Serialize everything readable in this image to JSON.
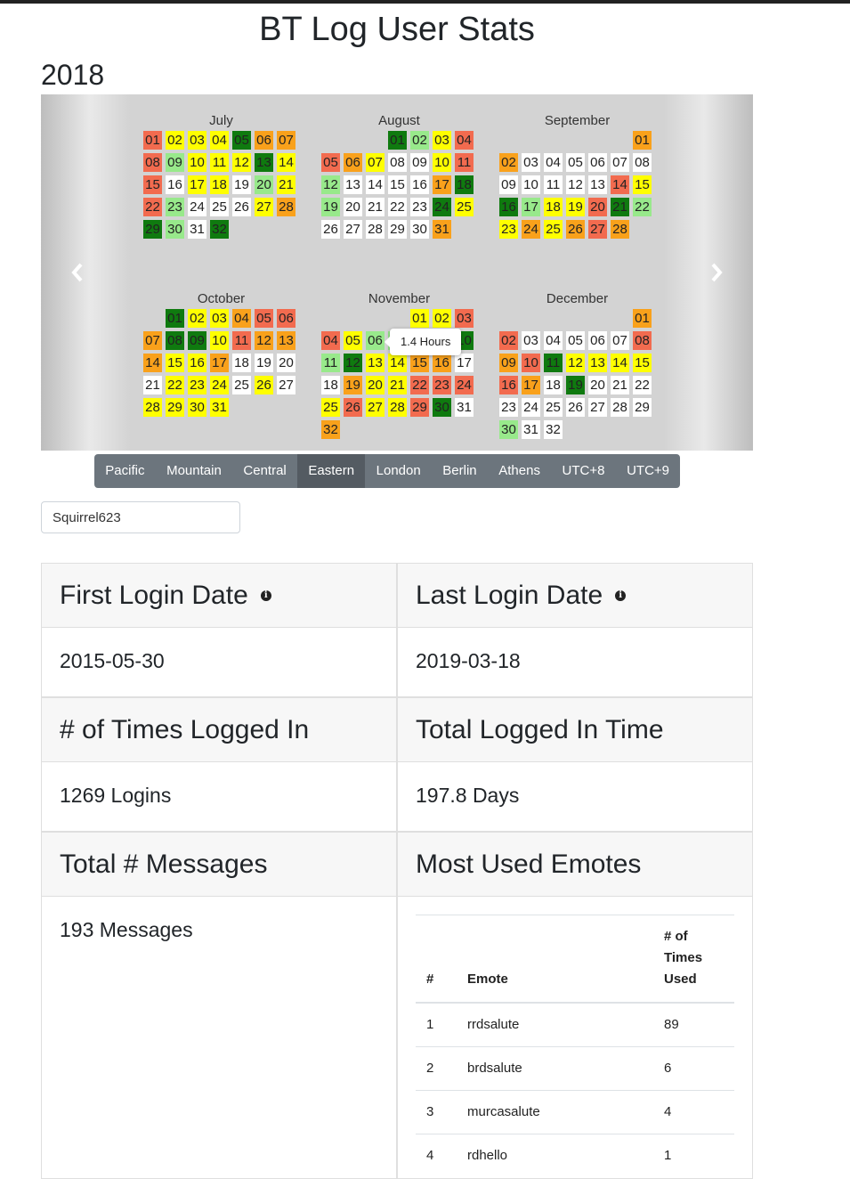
{
  "page_title": "BT Log User Stats",
  "year": "2018",
  "tooltip": "1.4 Hours",
  "colors": {
    "red": "#f26b4f",
    "yellow": "#ffff00",
    "orange": "#f9a11b",
    "green": "#0f7a0f",
    "lightgreen": "#98e98b",
    "white": "#ffffff"
  },
  "carousel": {
    "prev_icon": "chevron-left-icon",
    "next_icon": "chevron-right-icon"
  },
  "months": [
    {
      "name": "July",
      "offset": 0,
      "colors": "ryyygoorlyyygyrwyywlyrlwwwyoglwg"
    },
    {
      "name": "August",
      "offset": 3,
      "colors": "glyrroywwyrlwwwwoglwwwwgywwwwwo"
    },
    {
      "name": "September",
      "offset": 6,
      "colors": "oowwwwwwwwwwwryglyyrglyoyoro"
    },
    {
      "name": "October",
      "offset": 1,
      "colors": "gyyorroggyroooyyowwwwyyywywyyyy"
    },
    {
      "name": "November",
      "offset": 4,
      "colors": "yyrryllryglgyyoowwoyyrrryryyrgwo"
    },
    {
      "name": "December",
      "offset": 6,
      "colors": "orwwwwwrorgyyyyrowgwwwwwwwwwwlww"
    }
  ],
  "timezones": {
    "items": [
      "Pacific",
      "Mountain",
      "Central",
      "Eastern",
      "London",
      "Berlin",
      "Athens",
      "UTC+8",
      "UTC+9"
    ],
    "active": "Eastern"
  },
  "username": "Squirrel623",
  "cards": {
    "first_login": {
      "title": "First Login Date",
      "value": "2015-05-30"
    },
    "last_login": {
      "title": "Last Login Date",
      "value": "2019-03-18"
    },
    "times_logged_in": {
      "title": "# of Times Logged In",
      "value": "1269 Logins"
    },
    "total_time": {
      "title": "Total Logged In Time",
      "value": "197.8 Days"
    },
    "total_messages": {
      "title": "Total # Messages",
      "value": "193 Messages"
    },
    "emotes": {
      "title": "Most Used Emotes",
      "headers": [
        "#",
        "Emote",
        "# of Times Used"
      ],
      "rows": [
        [
          "1",
          "rrdsalute",
          "89"
        ],
        [
          "2",
          "brdsalute",
          "6"
        ],
        [
          "3",
          "murcasalute",
          "4"
        ],
        [
          "4",
          "rdhello",
          "1"
        ]
      ]
    }
  }
}
